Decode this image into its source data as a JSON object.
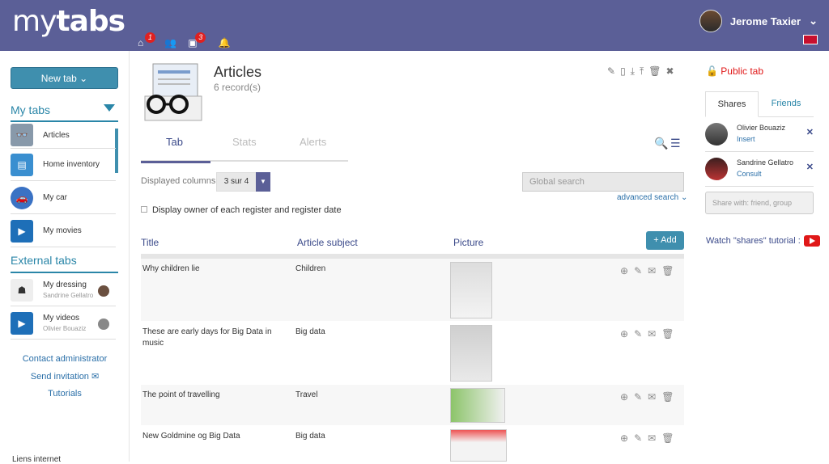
{
  "app": {
    "logo_light": "my",
    "logo_bold": "tabs"
  },
  "topnav": {
    "home_badge": "1",
    "images_badge": "3"
  },
  "user": {
    "name": "Jerome Taxier"
  },
  "sidebar": {
    "new_tab": "New tab",
    "my_tabs_title": "My tabs",
    "my_tabs": [
      {
        "label": "Articles"
      },
      {
        "label": "Home inventory"
      },
      {
        "label": "My car"
      },
      {
        "label": "My movies"
      }
    ],
    "external_title": "External tabs",
    "external": [
      {
        "label": "My dressing",
        "owner": "Sandrine Gellatro"
      },
      {
        "label": "My videos",
        "owner": "Olivier Bouaziz"
      }
    ],
    "links": {
      "contact": "Contact administrator",
      "invite": "Send invitation",
      "tutorials": "Tutorials"
    },
    "partial_item": "Liens internet"
  },
  "main": {
    "title": "Articles",
    "records": "6 record(s)",
    "tabs": [
      "Tab",
      "Stats",
      "Alerts"
    ],
    "displayed_columns_label": "Displayed columns",
    "columns_value": "3 sur 4",
    "global_search_placeholder": "Global search",
    "advanced_search": "advanced search",
    "owner_checkbox": "Display owner of each register and register date",
    "headers": {
      "title": "Title",
      "subject": "Article subject",
      "picture": "Picture"
    },
    "add_label": "+ Add",
    "rows": [
      {
        "title": "Why children lie",
        "subject": "Children"
      },
      {
        "title": "These are early days for Big Data in music",
        "subject": "Big data"
      },
      {
        "title": "The point of travelling",
        "subject": "Travel"
      },
      {
        "title": "New Goldmine og Big Data",
        "subject": "Big data"
      }
    ]
  },
  "right": {
    "public_tab": "Public tab",
    "tabs": {
      "shares": "Shares",
      "friends": "Friends"
    },
    "shares": [
      {
        "name": "Olivier Bouaziz",
        "role": "Insert"
      },
      {
        "name": "Sandrine Gellatro",
        "role": "Consult"
      }
    ],
    "share_placeholder": "Share with: friend, group",
    "tutorial": "Watch \"shares\" tutorial :"
  },
  "colors": {
    "topbar": "#5b5f97",
    "accent": "#3f8fae",
    "link": "#2a86a8",
    "alert": "#e01818"
  }
}
